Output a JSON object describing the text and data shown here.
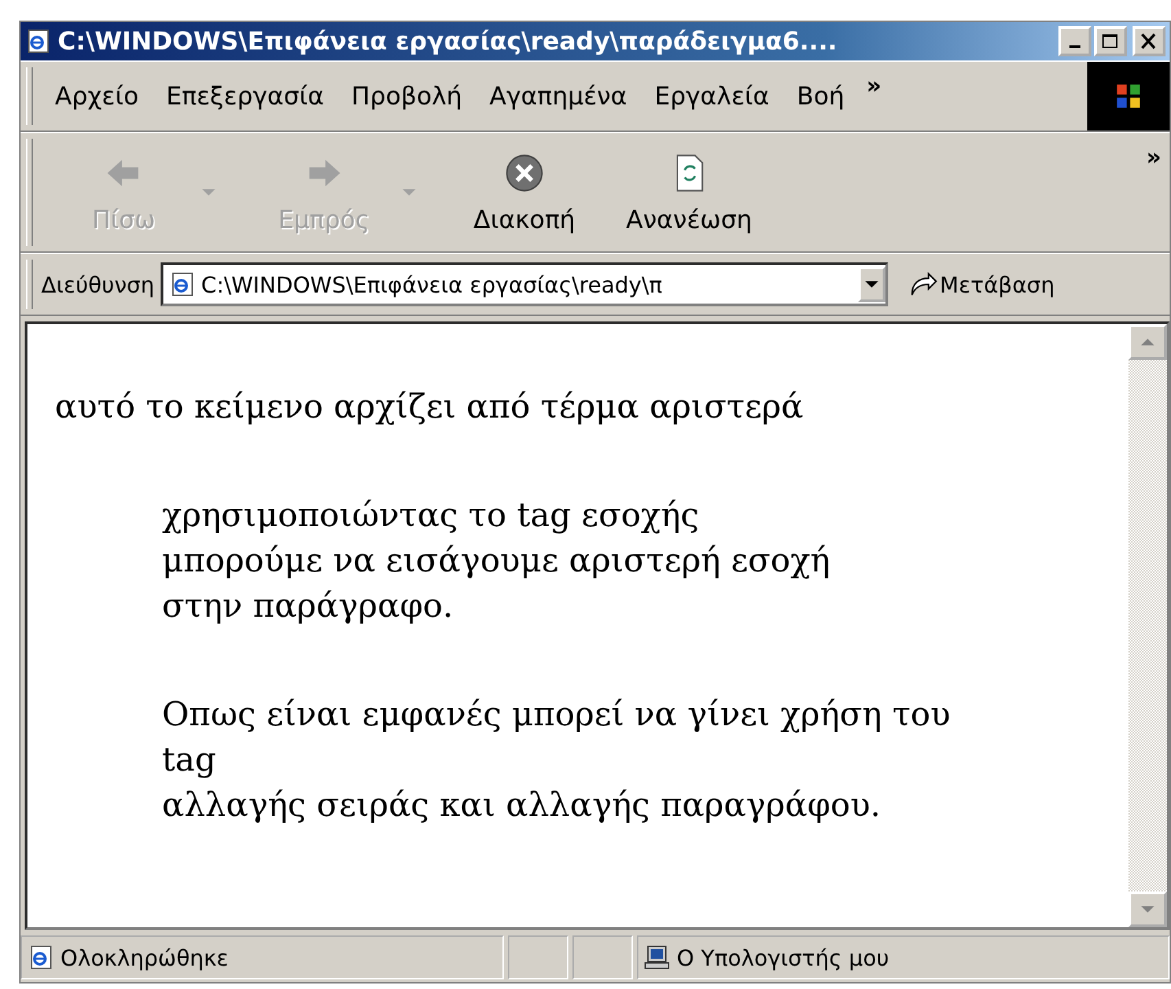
{
  "window": {
    "title": "C:\\WINDOWS\\Επιφάνεια εργασίας\\ready\\παράδειγμα6...."
  },
  "menu": [
    "Αρχείο",
    "Επεξεργασία",
    "Προβολή",
    "Αγαπημένα",
    "Εργαλεία",
    "Βοή"
  ],
  "menu_more": "»",
  "toolbar": [
    {
      "label": "Πίσω",
      "kind": "back",
      "disabled": true,
      "dropdown": true
    },
    {
      "label": "Εμπρός",
      "kind": "forward",
      "disabled": true,
      "dropdown": true
    },
    {
      "label": "Διακοπή",
      "kind": "stop",
      "disabled": false,
      "dropdown": false
    },
    {
      "label": "Ανανέωση",
      "kind": "refresh",
      "disabled": false,
      "dropdown": false
    }
  ],
  "toolbar_more": "»",
  "address": {
    "label": "Διεύθυνση",
    "value": "C:\\WINDOWS\\Επιφάνεια εργασίας\\ready\\π",
    "go": "Μετάβαση"
  },
  "content": {
    "intro": "αυτό το κείμενο αρχίζει από τέρμα αριστερά",
    "blockquote": [
      [
        "χρησιμοποιώντας το tag εσοχής",
        "μπορούμε να εισάγουμε αριστερή εσοχή",
        "στην παράγραφο."
      ],
      [
        "Οπως είναι εμφανές μπορεί να γίνει χρήση του",
        "tag",
        "αλλαγής σειράς και αλλαγής παραγράφου."
      ]
    ]
  },
  "status_bar": {
    "text": "Ολοκληρώθηκε",
    "zone": "Ο Υπολογιστής μου"
  }
}
